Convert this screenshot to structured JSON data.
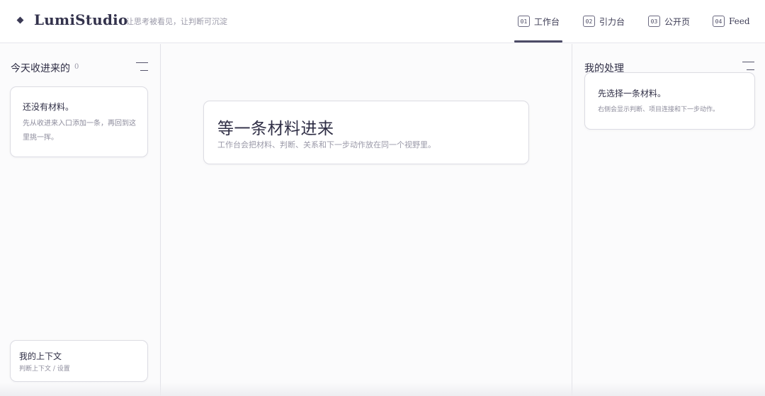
{
  "app": {
    "name": "LumiStudio",
    "tagline": "让思考被看见，让判断可沉淀"
  },
  "nav": {
    "tabs": [
      {
        "num": "01",
        "label": "工作台",
        "active": true
      },
      {
        "num": "02",
        "label": "引力台",
        "active": false
      },
      {
        "num": "03",
        "label": "公开页",
        "active": false
      },
      {
        "num": "04",
        "label": "Feed",
        "active": false
      }
    ]
  },
  "inbox": {
    "title": "今天收进来的",
    "count": "0",
    "empty_title": "还没有材料。",
    "empty_desc": "先从收进来入口添加一条，再回到这里挑一挥。"
  },
  "context": {
    "title": "我的上下文",
    "subtitle": "判断上下文 / 设置"
  },
  "workspace": {
    "title": "等一条材料进来",
    "subtitle": "工作台会把材料、判断、关系和下一步动作放在同一个视野里。"
  },
  "processing": {
    "title": "我的处理",
    "card_title": "先选择一条材料。",
    "card_desc": "右侧会显示判断、项目连接和下一步动作。"
  },
  "colors": {
    "accent": "#4c4b66",
    "text": "#2f2e45",
    "muted": "#9a99a8",
    "border": "#dcdce3",
    "background": "#fbfbfc"
  },
  "icons": {
    "logo": "diamond-icon",
    "menu": "menu-lines-icon"
  }
}
